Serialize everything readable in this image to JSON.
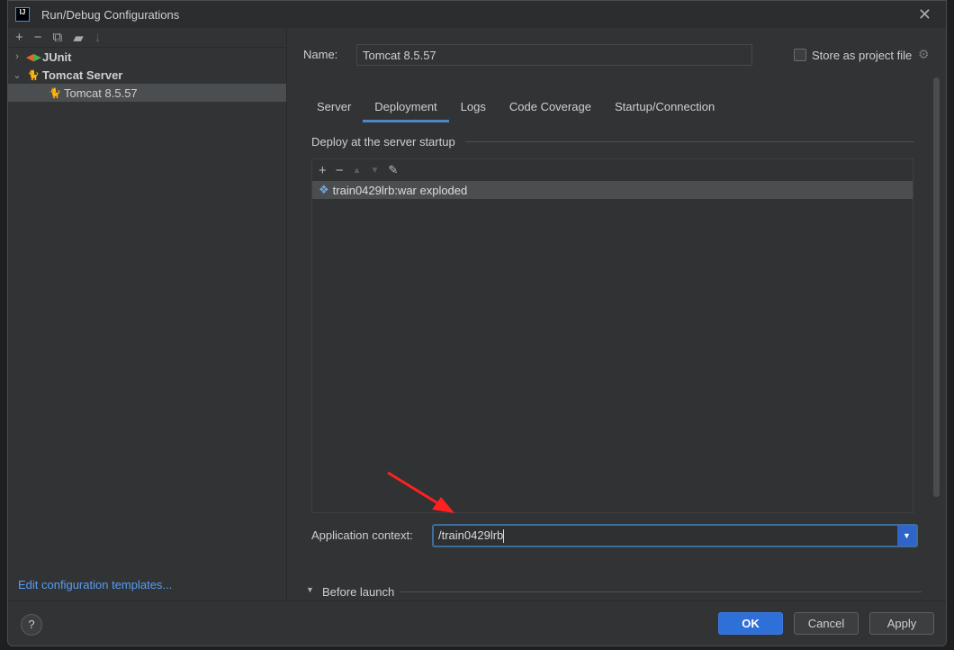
{
  "window": {
    "title": "Run/Debug Configurations",
    "logo": "IJ"
  },
  "left": {
    "toolbar": [
      "add-icon",
      "remove-icon",
      "copy-icon",
      "new-folder-icon",
      "sort-icon"
    ],
    "tree": [
      {
        "label": "JUnit",
        "expanded": false
      },
      {
        "label": "Tomcat Server",
        "expanded": true
      },
      {
        "label": "Tomcat 8.5.57",
        "selected": true
      }
    ],
    "edit_templates": "Edit configuration templates..."
  },
  "form": {
    "name_label": "Name:",
    "name_value": "Tomcat 8.5.57",
    "store_label": "Store as project file",
    "store_checked": false,
    "tabs": [
      "Server",
      "Deployment",
      "Logs",
      "Code Coverage",
      "Startup/Connection"
    ],
    "active_tab": "Deployment",
    "deploy_header": "Deploy at the server startup",
    "artifacts": [
      "train0429lrb:war exploded"
    ],
    "context_label": "Application context:",
    "context_value": "/train0429lrb",
    "before_launch": "Before launch"
  },
  "footer": {
    "help": "?",
    "ok": "OK",
    "cancel": "Cancel",
    "apply": "Apply"
  },
  "colors": {
    "accent": "#2f6fd8",
    "annotation_arrow": "#ff2020"
  }
}
